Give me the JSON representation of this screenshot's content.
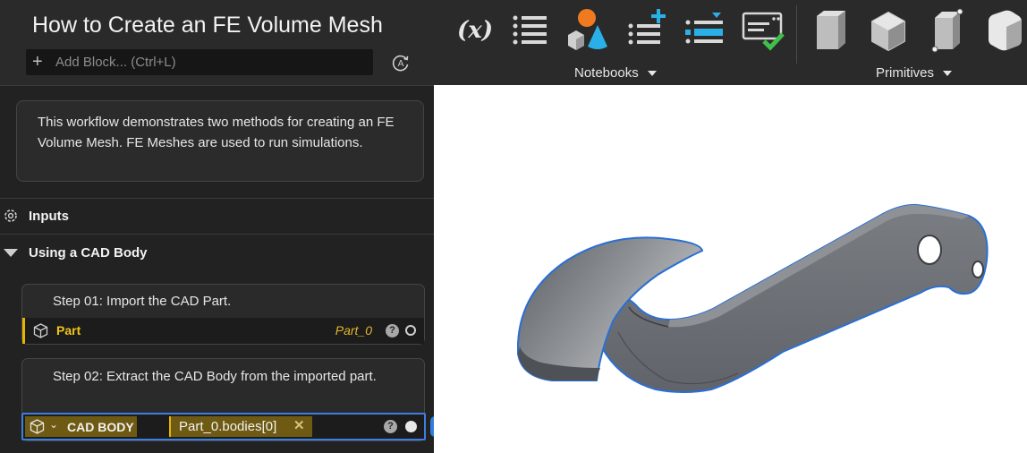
{
  "workflow": {
    "title": "How to Create an FE Volume Mesh",
    "add_block_placeholder": "Add Block... (Ctrl+L)",
    "description": "This workflow demonstrates two methods for creating an FE Volume Mesh. FE Meshes are used to run simulations."
  },
  "sections": {
    "inputs_label": "Inputs",
    "cad_section_label": "Using a CAD Body"
  },
  "steps": [
    {
      "text": "Step 01: Import the CAD Part.",
      "row": {
        "label": "Part",
        "value": "Part_0",
        "help": "?"
      }
    },
    {
      "text": "Step 02: Extract the CAD Body from the imported part.",
      "row": {
        "label": "CAD BODY",
        "value": "Part_0.bodies[0]",
        "clear": "✕",
        "help": "?"
      }
    }
  ],
  "toolbar": {
    "notebooks_label": "Notebooks",
    "primitives_label": "Primitives",
    "variable_icon_text": "(x)",
    "icons": [
      "variable-icon",
      "list-icon",
      "shapes-icon",
      "add-list-icon",
      "insert-list-icon",
      "checked-document-icon",
      "box-primitive-icon",
      "rounded-box-primitive-icon",
      "box-corner-primitive-icon",
      "smooth-box-primitive-icon"
    ]
  },
  "colors": {
    "accent_blue": "#2f7fe0",
    "highlight_gold": "#e7b400",
    "chip_gold": "#6e5a12",
    "part_gray": "#6f7378"
  }
}
